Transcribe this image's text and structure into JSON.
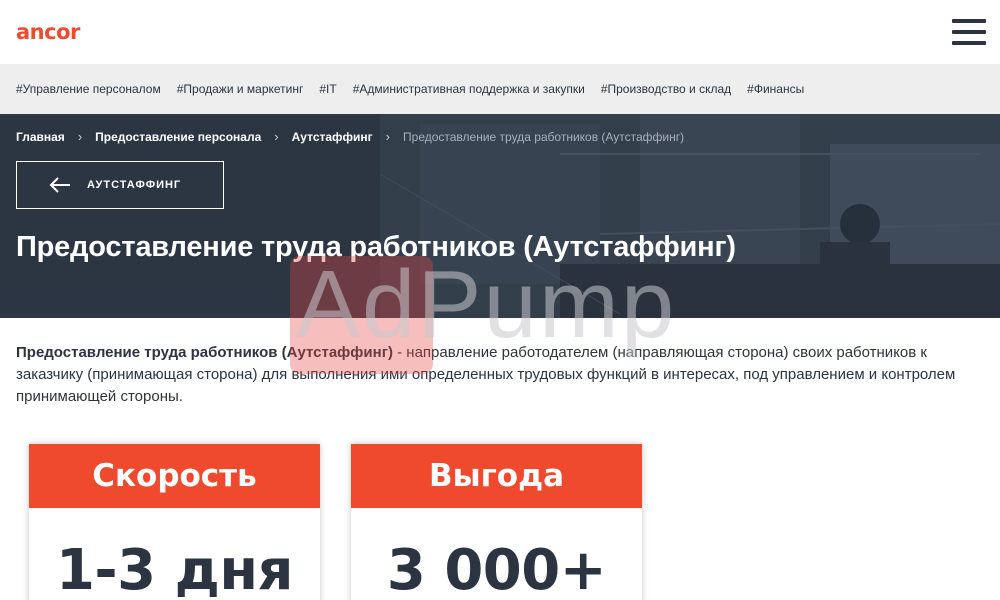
{
  "header": {
    "logo": "ancor",
    "colors": {
      "brand": "#f04a2e",
      "text": "#2b3440"
    }
  },
  "tags": [
    "#Управление персоналом",
    "#Продажи и маркетинг",
    "#IT",
    "#Административная поддержка и закупки",
    "#Производство и склад",
    "#Финансы"
  ],
  "breadcrumbs": {
    "home": "Главная",
    "level1": "Предоставление персонала",
    "level2": "Аутстаффинг",
    "current": "Предоставление труда работников (Аутстаффинг)",
    "separator": "›"
  },
  "back_button": {
    "label": "АУТСТАФФИНГ",
    "icon": "arrow-left-icon"
  },
  "page_title": "Предоставление труда работников (Аутстаффинг)",
  "intro": {
    "bold": "Предоставление труда работников (Аутстаффинг)",
    "text": " - направление работодателем (направляющая сторона) своих работников к заказчику (принимающая сторона) для выполнения ими определенных трудовых функций в интересах, под управлением и контролем принимающей стороны."
  },
  "cards": [
    {
      "title": "Скорость",
      "value": "1-3 дня"
    },
    {
      "title": "Выгода",
      "value": "3 000+"
    }
  ],
  "watermark": "AdPump"
}
